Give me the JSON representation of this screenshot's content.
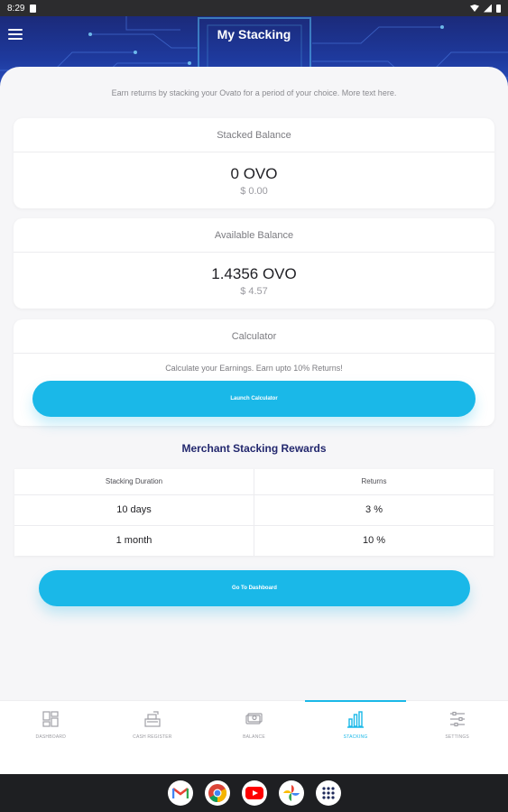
{
  "status_bar": {
    "time": "8:29"
  },
  "header": {
    "title": "My Stacking"
  },
  "intro_text": "Earn returns by stacking your Ovato for a period of your choice. More text here.",
  "stacked_balance": {
    "label": "Stacked Balance",
    "amount": "0 OVO",
    "fiat": "$ 0.00"
  },
  "available_balance": {
    "label": "Available Balance",
    "amount": "1.4356 OVO",
    "fiat": "$ 4.57"
  },
  "calculator": {
    "label": "Calculator",
    "note": "Calculate your Earnings. Earn upto 10% Returns!",
    "button": "Launch Calculator"
  },
  "rewards": {
    "title": "Merchant Stacking Rewards",
    "headers": [
      "Stacking Duration",
      "Returns"
    ],
    "rows": [
      [
        "10 days",
        "3 %"
      ],
      [
        "1 month",
        "10 %"
      ]
    ]
  },
  "dashboard_button": "Go To Dashboard",
  "bottom_nav": [
    {
      "label": "DASHBOARD",
      "icon": "dashboard-icon",
      "active": false
    },
    {
      "label": "CASH REGISTER",
      "icon": "cash-register-icon",
      "active": false
    },
    {
      "label": "BALANCE",
      "icon": "balance-icon",
      "active": false
    },
    {
      "label": "STACKING",
      "icon": "stacking-icon",
      "active": true
    },
    {
      "label": "SETTINGS",
      "icon": "settings-icon",
      "active": false
    }
  ],
  "dock_apps": [
    "gmail-icon",
    "chrome-icon",
    "youtube-icon",
    "photos-icon",
    "app-drawer-icon"
  ],
  "colors": {
    "accent": "#1ab8e8",
    "header": "#1e3a9e",
    "title_navy": "#23286e"
  }
}
